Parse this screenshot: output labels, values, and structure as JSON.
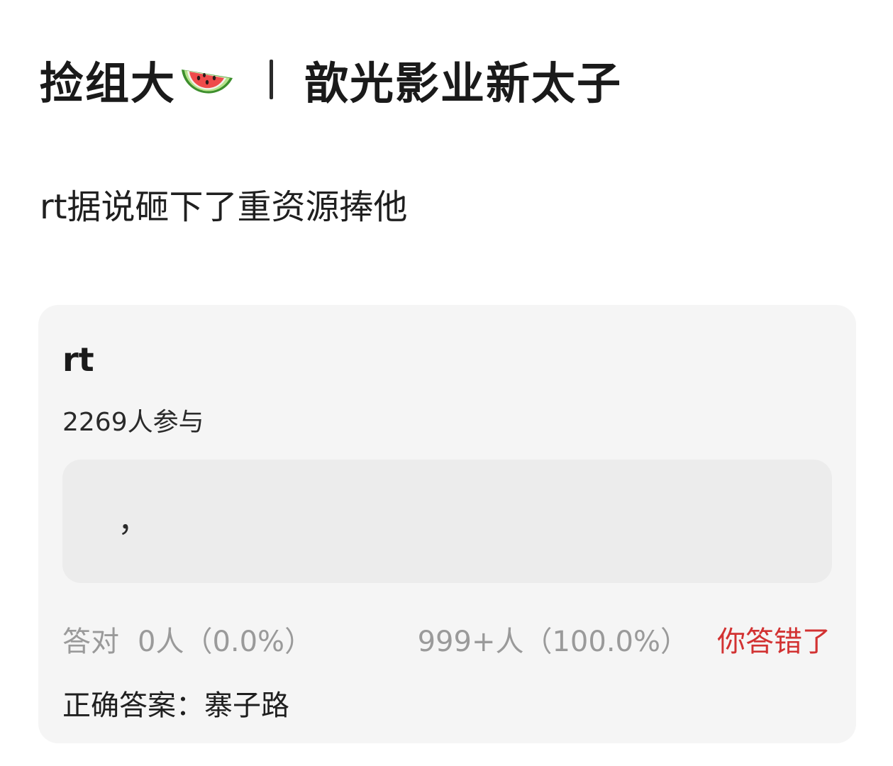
{
  "post": {
    "title_part1": "捡组大",
    "title_part2": "歆光影业新太子",
    "body": "rt据说砸下了重资源捧他"
  },
  "poll": {
    "question": "rt",
    "participants": "2269人参与",
    "option_text": "，",
    "correct_label": "答对",
    "correct_stats": "0人（0.0%）",
    "wrong_stats": "999+人（100.0%）",
    "result_text": "你答错了",
    "answer_line": "正确答案：寨子路"
  },
  "colors": {
    "card_bg": "#f5f5f5",
    "option_bg": "#ececec",
    "muted_text": "#9a9a9a",
    "wrong_red": "#d23232"
  },
  "icons": {
    "melon": "watermelon-slice-icon"
  }
}
